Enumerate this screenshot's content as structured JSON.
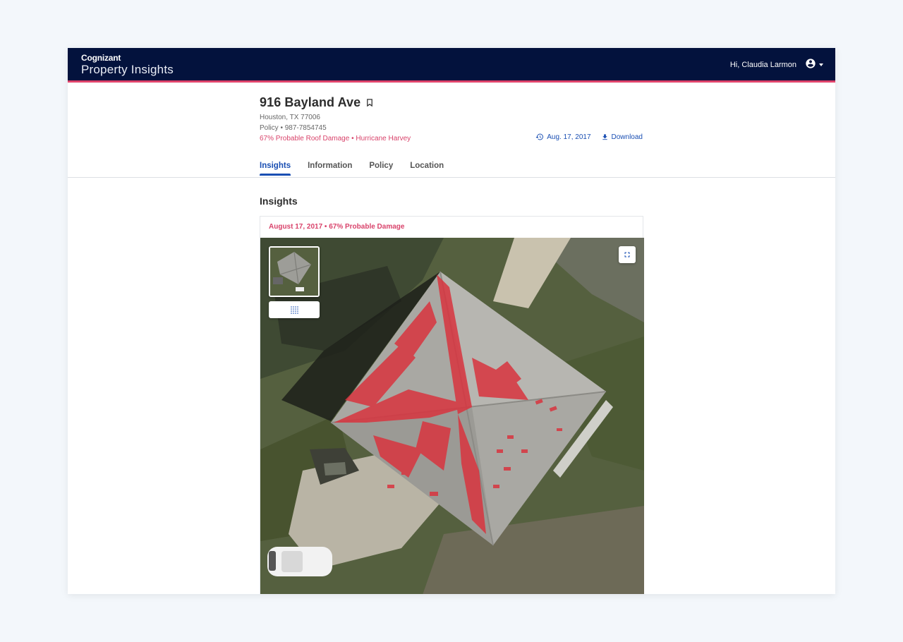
{
  "brand": {
    "company": "Cognizant",
    "product": "Property Insights"
  },
  "user": {
    "greeting": "Hi, Claudia Larmon",
    "avatar_icon": "account-circle-icon"
  },
  "property": {
    "address": "916 Bayland Ave",
    "city_state_zip": "Houston, TX 77006",
    "policy_line": "Policy • 987-7854745",
    "damage_summary": "67% Probable Roof Damage • Hurricane Harvey"
  },
  "actions": {
    "history_date": "Aug. 17, 2017",
    "download_label": "Download"
  },
  "tabs": [
    {
      "label": "Insights",
      "active": true
    },
    {
      "label": "Information",
      "active": false
    },
    {
      "label": "Policy",
      "active": false
    },
    {
      "label": "Location",
      "active": false
    }
  ],
  "insights": {
    "section_title": "Insights",
    "card_label": "August 17, 2017 • 67% Probable Damage"
  },
  "colors": {
    "nav_bg": "#03123d",
    "accent": "#e0436b",
    "link": "#1a4fb3",
    "damage_overlay": "#d9343f"
  }
}
